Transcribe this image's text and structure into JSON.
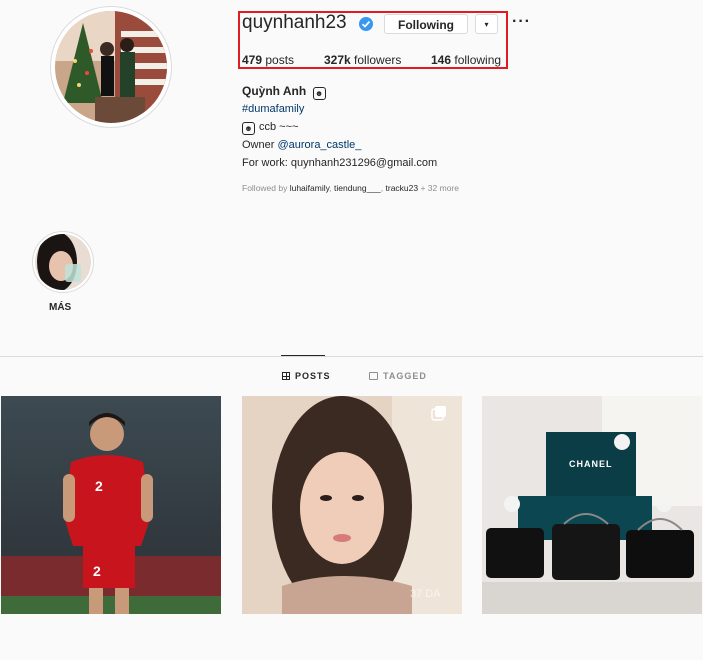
{
  "profile": {
    "username": "quynhanh23",
    "following_button": "Following",
    "dropdown_caret": "▾",
    "more": "···",
    "stats": {
      "posts_count": "479",
      "posts_label": " posts",
      "followers_count": "327k",
      "followers_label": " followers",
      "following_count": "146",
      "following_label": " following"
    },
    "bio": {
      "name": "Quỳnh Anh",
      "hashtag": "#dumafamily",
      "ccb": "ccb ~~~",
      "owner_prefix": "Owner ",
      "owner_link": "@aurora_castle_",
      "work": "For work: quynhanh231296@gmail.com"
    },
    "followed_by": {
      "prefix": "Followed by ",
      "names": [
        "luhaifamily",
        "tiendung___",
        "tracku23"
      ],
      "suffix": " + 32 more"
    }
  },
  "highlights": [
    {
      "label": "MÁS"
    }
  ],
  "tabs": [
    {
      "label": "POSTS",
      "active": true
    },
    {
      "label": "TAGGED",
      "active": false
    }
  ],
  "posts": [
    {
      "jersey": "2"
    },
    {
      "watermark": "37 DA"
    },
    {
      "brand": "CHANEL"
    }
  ],
  "colors": {
    "highlight_box": "#e01b24",
    "link": "#00376b",
    "verified": "#3897f0"
  }
}
